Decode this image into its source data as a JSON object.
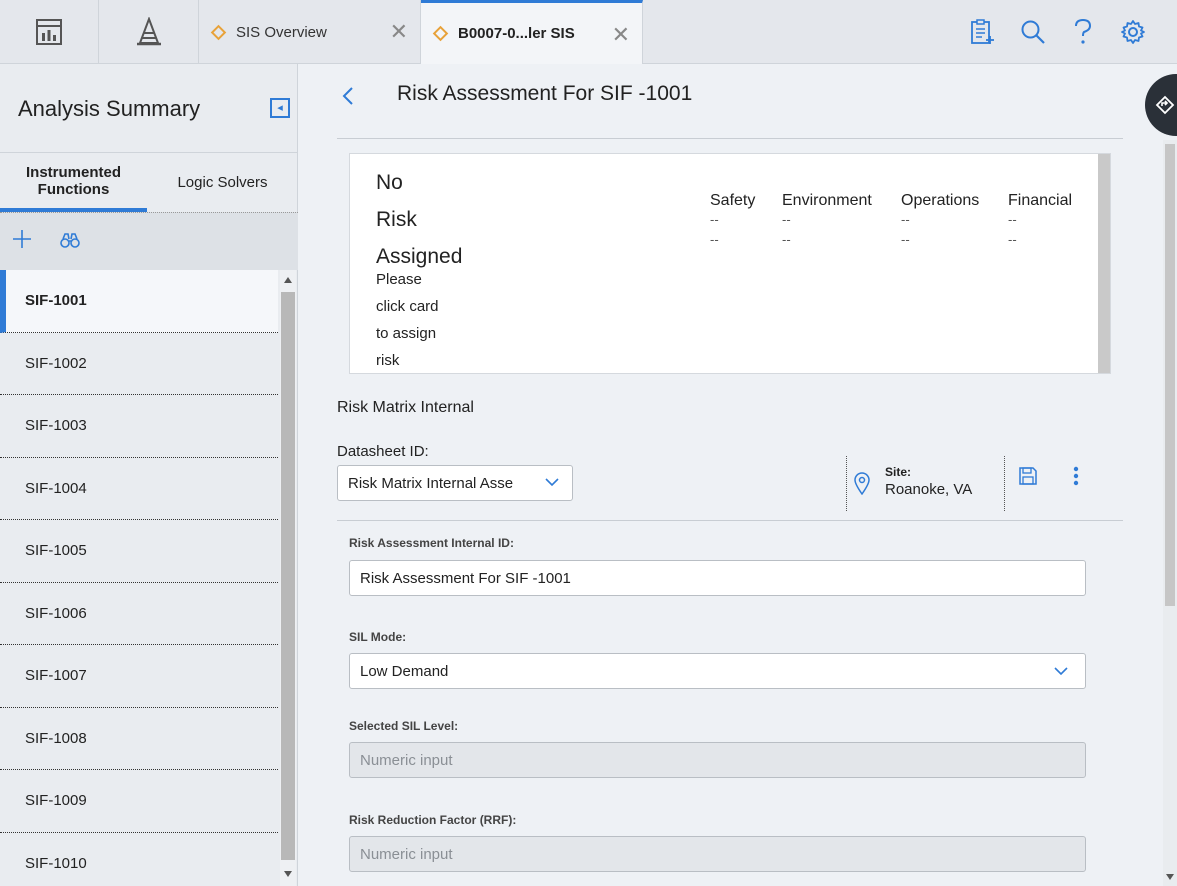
{
  "topbar": {
    "tabs": [
      {
        "label": "SIS Overview",
        "close": "✕"
      },
      {
        "label": "B0007-0...ler SIS",
        "close": "✕"
      }
    ]
  },
  "sidebar": {
    "title": "Analysis Summary",
    "tabs": [
      "Instrumented Functions",
      "Logic Solvers"
    ],
    "items": [
      "SIF-1001",
      "SIF-1002",
      "SIF-1003",
      "SIF-1004",
      "SIF-1005",
      "SIF-1006",
      "SIF-1007",
      "SIF-1008",
      "SIF-1009",
      "SIF-1010"
    ]
  },
  "main": {
    "title": "Risk Assessment For SIF -1001",
    "card": {
      "no_risk_lines": [
        "No",
        "Risk",
        "Assigned"
      ],
      "hint_lines": [
        "Please",
        "click card",
        "to assign",
        "risk"
      ],
      "categories": [
        {
          "name": "Safety",
          "v1": "--",
          "v2": "--"
        },
        {
          "name": "Environment",
          "v1": "--",
          "v2": "--"
        },
        {
          "name": "Operations",
          "v1": "--",
          "v2": "--"
        },
        {
          "name": "Financial",
          "v1": "--",
          "v2": "--"
        }
      ]
    },
    "section_title": "Risk Matrix Internal",
    "datasheet": {
      "label": "Datasheet ID:",
      "value": "Risk Matrix Internal Asse"
    },
    "site": {
      "label": "Site:",
      "value": "Roanoke, VA"
    },
    "fields": [
      {
        "label": "Risk Assessment Internal ID:",
        "value": "Risk Assessment For SIF -1001"
      },
      {
        "label": "SIL Mode:",
        "value": "Low Demand"
      },
      {
        "label": "Selected SIL Level:",
        "placeholder": "Numeric input"
      },
      {
        "label": "Risk Reduction Factor (RRF):",
        "placeholder": "Numeric input"
      }
    ]
  },
  "colors": {
    "accent": "#2f7bd6",
    "tab_diamond": "#e8a23a",
    "fab": "#2a3038"
  }
}
